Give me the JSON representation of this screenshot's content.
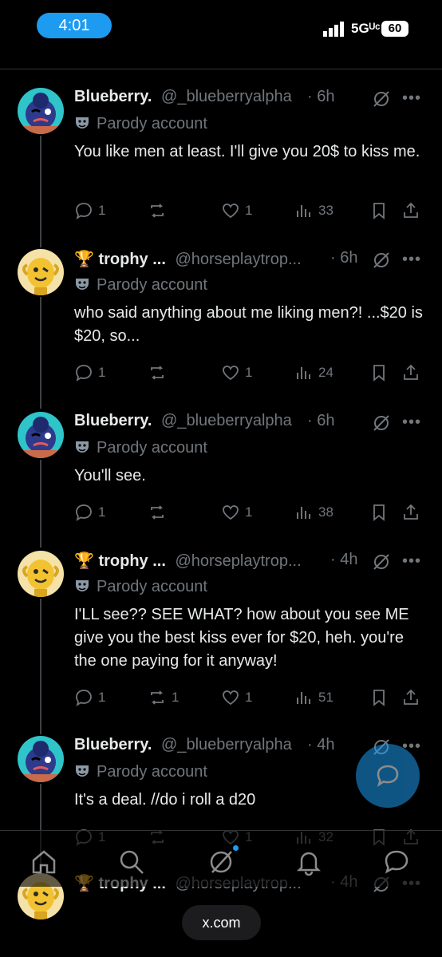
{
  "status_bar": {
    "time": "4:01",
    "network": "5Gᵁᶜ",
    "battery": "60"
  },
  "tweets": [
    {
      "name": "Blueberry.",
      "handle": "@_blueberryalpha",
      "time": "· 6h",
      "label": "Parody account",
      "text": "You like men at least. I'll give you 20$ to kiss me.",
      "replies": "1",
      "reposts": "",
      "likes": "1",
      "views": "33",
      "avatar": "blueberry"
    },
    {
      "name": "🏆 trophy ...",
      "handle": "@horseplaytrop...",
      "time": "· 6h",
      "label": "Parody account",
      "text": "who said anything about me liking men?! ...$20 is $20, so...",
      "replies": "1",
      "reposts": "",
      "likes": "1",
      "views": "24",
      "avatar": "trophy"
    },
    {
      "name": "Blueberry.",
      "handle": "@_blueberryalpha",
      "time": "· 6h",
      "label": "Parody account",
      "text": "You'll see.",
      "replies": "1",
      "reposts": "",
      "likes": "1",
      "views": "38",
      "avatar": "blueberry"
    },
    {
      "name": "🏆 trophy ...",
      "handle": "@horseplaytrop...",
      "time": "· 4h",
      "label": "Parody account",
      "text": "I'LL see?? SEE WHAT? how about you see ME give you the best kiss ever for $20, heh. you're the one paying for it anyway!",
      "replies": "1",
      "reposts": "1",
      "likes": "1",
      "views": "51",
      "avatar": "trophy"
    },
    {
      "name": "Blueberry.",
      "handle": "@_blueberryalpha",
      "time": "· 4h",
      "label": "Parody account",
      "text": "It's a deal. //do i roll a d20",
      "replies": "1",
      "reposts": "",
      "likes": "1",
      "views": "32",
      "avatar": "blueberry"
    },
    {
      "name": "🏆 trophy ...",
      "handle": "@horseplaytrop...",
      "time": "· 4h",
      "label": "",
      "text": "",
      "replies": "",
      "reposts": "",
      "likes": "",
      "views": "",
      "avatar": "trophy"
    }
  ],
  "browser": {
    "url": "x.com"
  },
  "colors": {
    "accent": "#1d9bf0",
    "background": "#000000",
    "muted": "#71767b",
    "text": "#e7e9ea"
  },
  "icons": [
    "reply-icon",
    "repost-icon",
    "like-icon",
    "views-icon",
    "bookmark-icon",
    "share-icon",
    "grok-icon",
    "more-icon",
    "parody-mask-icon",
    "compose-fab-icon",
    "home-icon",
    "search-icon",
    "grok-nav-icon",
    "notifications-icon",
    "messages-icon"
  ]
}
